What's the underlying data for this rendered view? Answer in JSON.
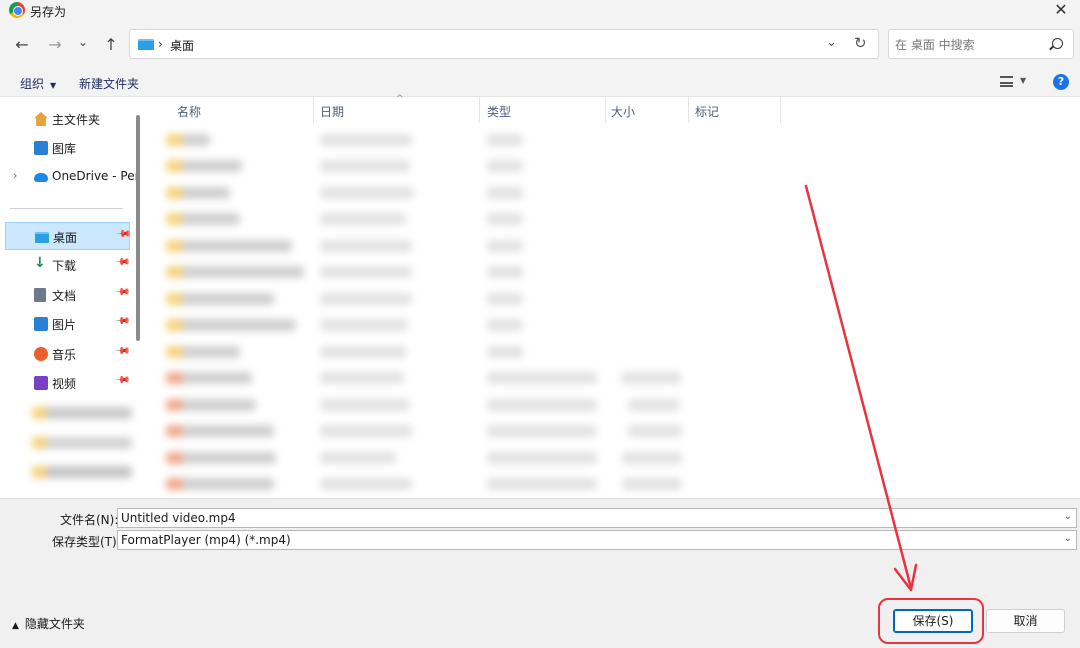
{
  "window": {
    "title": "另存为",
    "close_glyph": "✕"
  },
  "nav": {
    "back": "←",
    "forward": "→",
    "recent": "⌄",
    "up": "↑",
    "path_separator": "›",
    "path": "桌面",
    "dropdown": "⌄",
    "refresh": "↻",
    "search_placeholder": "在 桌面 中搜索"
  },
  "toolbar": {
    "organize": "组织",
    "organize_caret": "▼",
    "new_folder": "新建文件夹",
    "view_caret": "▼",
    "help": "?"
  },
  "sidebar": {
    "items": [
      {
        "label": "主文件夹"
      },
      {
        "label": "图库"
      },
      {
        "label": "OneDrive - Per",
        "expander": "›"
      },
      {
        "label": "桌面",
        "pin": "📌"
      },
      {
        "label": "下载",
        "pin": "📌"
      },
      {
        "label": "文档",
        "pin": "📌"
      },
      {
        "label": "图片",
        "pin": "📌"
      },
      {
        "label": "音乐",
        "pin": "📌"
      },
      {
        "label": "视频",
        "pin": "📌"
      }
    ],
    "download_glyph": "↓"
  },
  "columns": {
    "name": "名称",
    "date": "日期",
    "sort": "^",
    "type": "类型",
    "size": "大小",
    "tags": "标记"
  },
  "form": {
    "filename_label": "文件名(N):",
    "filename_value": "Untitled video.mp4",
    "filetype_label": "保存类型(T):",
    "filetype_value": "FormatPlayer (mp4) (*.mp4)",
    "caret": "⌄"
  },
  "footer": {
    "hide_folders": "隐藏文件夹",
    "hide_caret": "▲",
    "save": "保存(S)",
    "cancel": "取消"
  },
  "colors": {
    "accent": "#0067c0",
    "annotation": "#e8343f",
    "selection": "#cce8ff"
  }
}
